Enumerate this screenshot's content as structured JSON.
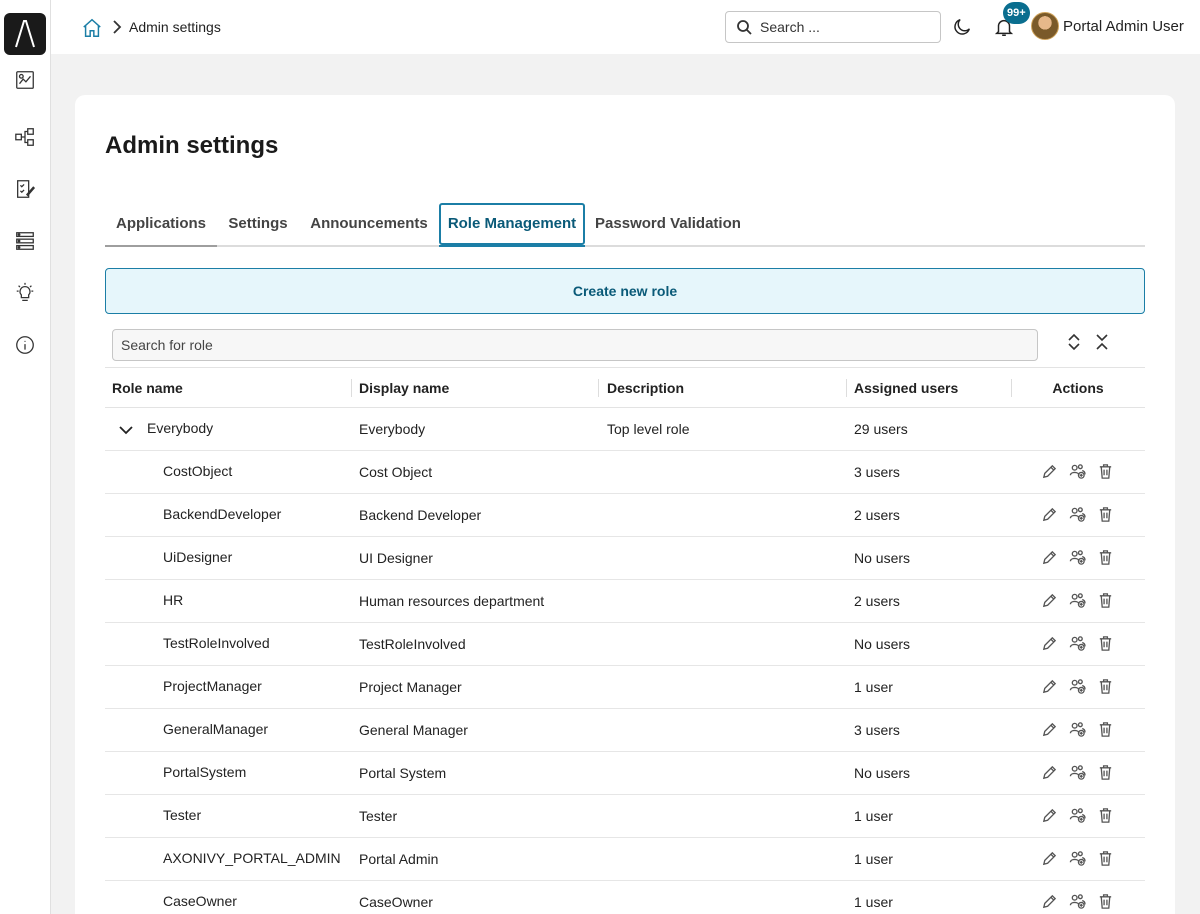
{
  "header": {
    "breadcrumb": "Admin settings",
    "search_placeholder": "Search ...",
    "notification_count": "99+",
    "user_name": "Portal Admin User"
  },
  "sidebar": {
    "items": [
      {
        "icon": "dashboard-icon"
      },
      {
        "icon": "process-icon"
      },
      {
        "icon": "task-icon"
      },
      {
        "icon": "case-list-icon"
      },
      {
        "icon": "idea-icon"
      },
      {
        "icon": "info-icon"
      }
    ]
  },
  "main": {
    "title": "Admin settings",
    "tabs": [
      "Applications",
      "Settings",
      "Announcements",
      "Role Management",
      "Password Validation"
    ],
    "active_tab": "Role Management",
    "create_button": "Create new role",
    "role_search_placeholder": "Search for role",
    "columns": [
      "Role name",
      "Display name",
      "Description",
      "Assigned users",
      "Actions"
    ],
    "rows": [
      {
        "name": "Everybody",
        "display": "Everybody",
        "description": "Top level role",
        "users": "29 users",
        "level": 0
      },
      {
        "name": "CostObject",
        "display": "Cost Object",
        "description": "",
        "users": "3 users",
        "level": 1
      },
      {
        "name": "BackendDeveloper",
        "display": "Backend Developer",
        "description": "",
        "users": "2 users",
        "level": 1
      },
      {
        "name": "UiDesigner",
        "display": "UI Designer",
        "description": "",
        "users": "No users",
        "level": 1
      },
      {
        "name": "HR",
        "display": "Human resources department",
        "description": "",
        "users": "2 users",
        "level": 1
      },
      {
        "name": "TestRoleInvolved",
        "display": "TestRoleInvolved",
        "description": "",
        "users": "No users",
        "level": 1
      },
      {
        "name": "ProjectManager",
        "display": "Project Manager",
        "description": "",
        "users": "1 user",
        "level": 1
      },
      {
        "name": "GeneralManager",
        "display": "General Manager",
        "description": "",
        "users": "3 users",
        "level": 1
      },
      {
        "name": "PortalSystem",
        "display": "Portal System",
        "description": "",
        "users": "No users",
        "level": 1
      },
      {
        "name": "Tester",
        "display": "Tester",
        "description": "",
        "users": "1 user",
        "level": 1
      },
      {
        "name": "AXONIVY_PORTAL_ADMIN",
        "display": "Portal Admin",
        "description": "",
        "users": "1 user",
        "level": 1
      },
      {
        "name": "CaseOwner",
        "display": "CaseOwner",
        "description": "",
        "users": "1 user",
        "level": 1
      }
    ]
  },
  "colors": {
    "accent": "#1b7ea6",
    "badge": "#0a6e8f",
    "create_button_bg": "#e6f6fb"
  }
}
